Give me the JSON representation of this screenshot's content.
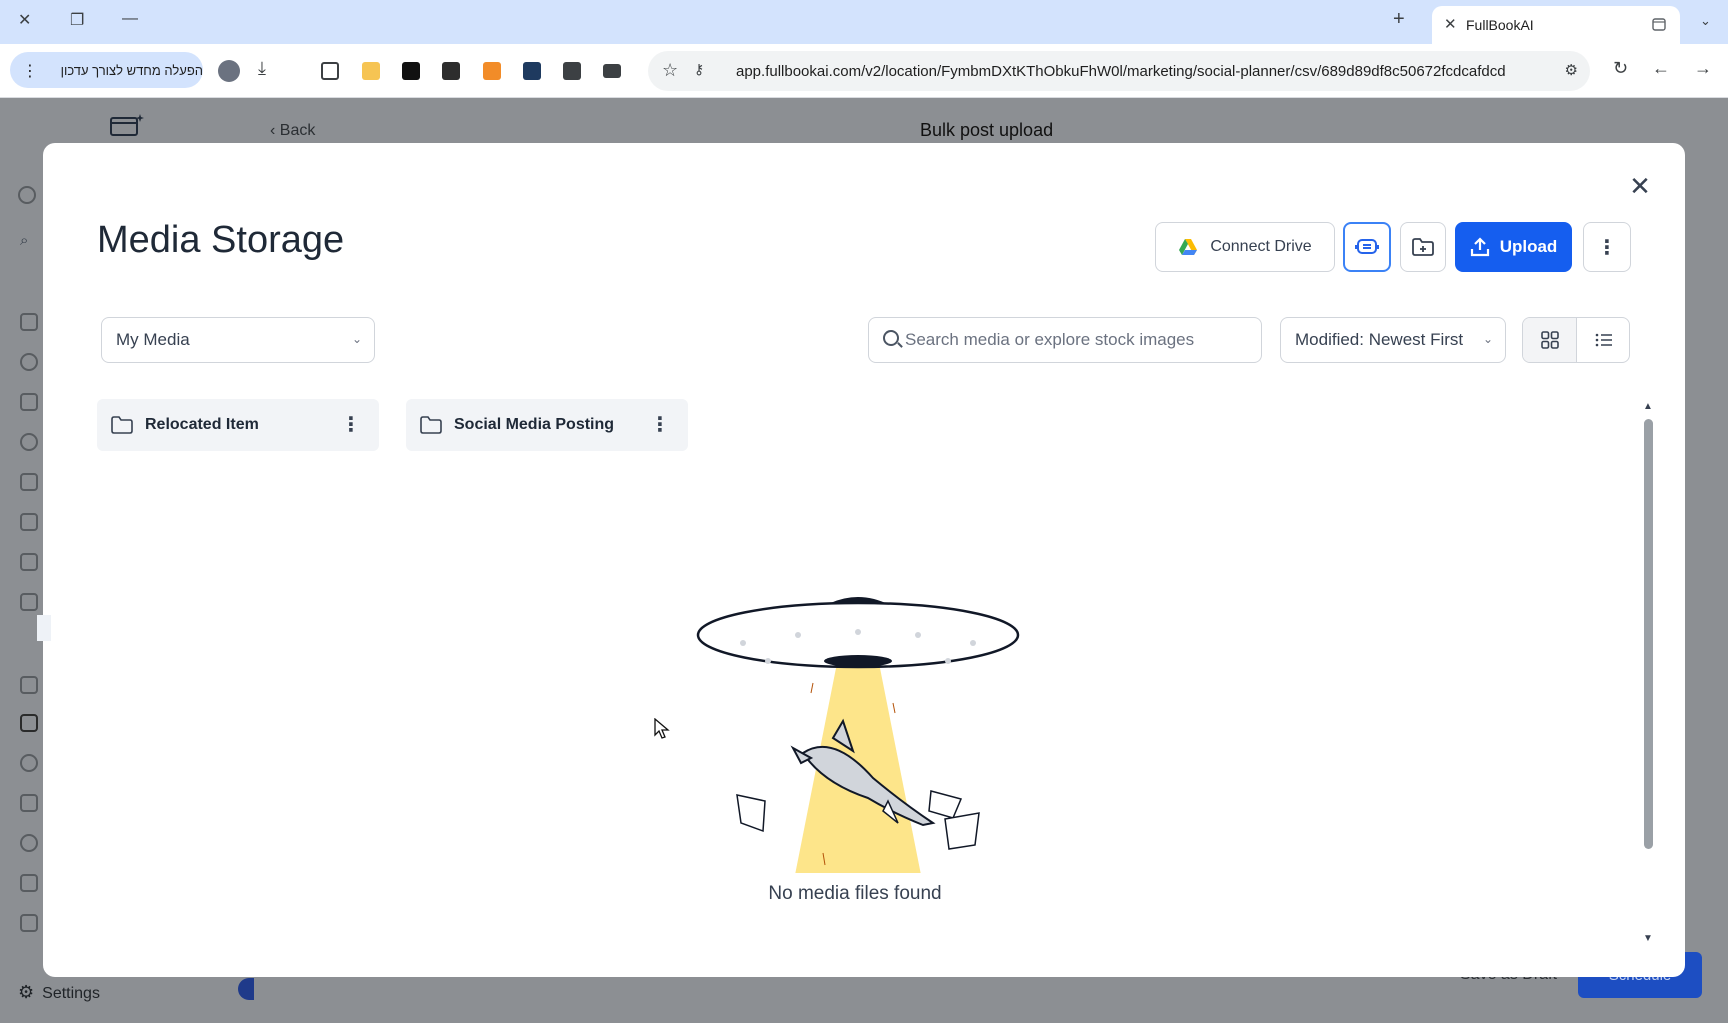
{
  "browser": {
    "tab_title": "FullBookAI",
    "update_label": "הפעלה מחדש לצורך עדכון",
    "url": "app.fullbookai.com/v2/location/FymbmDXtKThObkuFhW0l/marketing/social-planner/csv/689d89df8c50672fcdcafdcd"
  },
  "app": {
    "back_label": "Back",
    "page_title": "Bulk post upload",
    "settings_label": "Settings",
    "save_draft_label": "Save as Draft",
    "schedule_label": "Schedule"
  },
  "modal": {
    "title": "Media Storage",
    "connect_drive_label": "Connect Drive",
    "upload_label": "Upload",
    "filter_value": "My Media",
    "search_placeholder": "Search media or explore stock images",
    "sort_value": "Modified: Newest First",
    "folders": [
      {
        "name": "Relocated Item"
      },
      {
        "name": "Social Media Posting"
      }
    ],
    "empty_message": "No media files found"
  },
  "colors": {
    "primary": "#155eef",
    "tabbar": "#d3e3fd",
    "beam": "#fde58a"
  }
}
